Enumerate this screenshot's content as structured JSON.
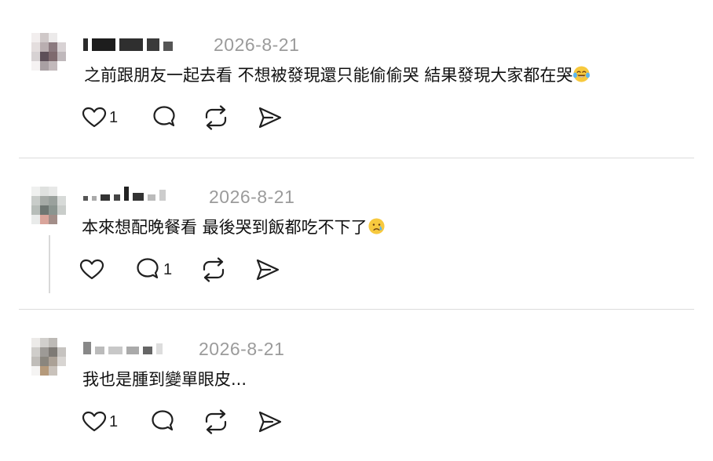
{
  "comments": [
    {
      "date": "2026-8-21",
      "text": "之前跟朋友一起去看 不想被發現還只能偷偷哭 結果發現大家都在哭",
      "emoji": "face-with-tears-of-joy",
      "likes": "1",
      "replies": ""
    },
    {
      "date": "2026-8-21",
      "text": "本來想配晚餐看 最後哭到飯都吃不下了",
      "emoji": "crying-face",
      "likes": "",
      "replies": "1"
    },
    {
      "date": "2026-8-21",
      "text": "我也是腫到變單眼皮...",
      "emoji": "",
      "likes": "1",
      "replies": ""
    }
  ],
  "icons": {
    "like": "heart-icon",
    "reply": "comment-bubble-icon",
    "repost": "repost-icon",
    "share": "send-icon"
  },
  "colors": {
    "text": "#111111",
    "meta": "#9b9b9b",
    "divider": "#dcdcdc",
    "icon": "#1f1f1f"
  }
}
